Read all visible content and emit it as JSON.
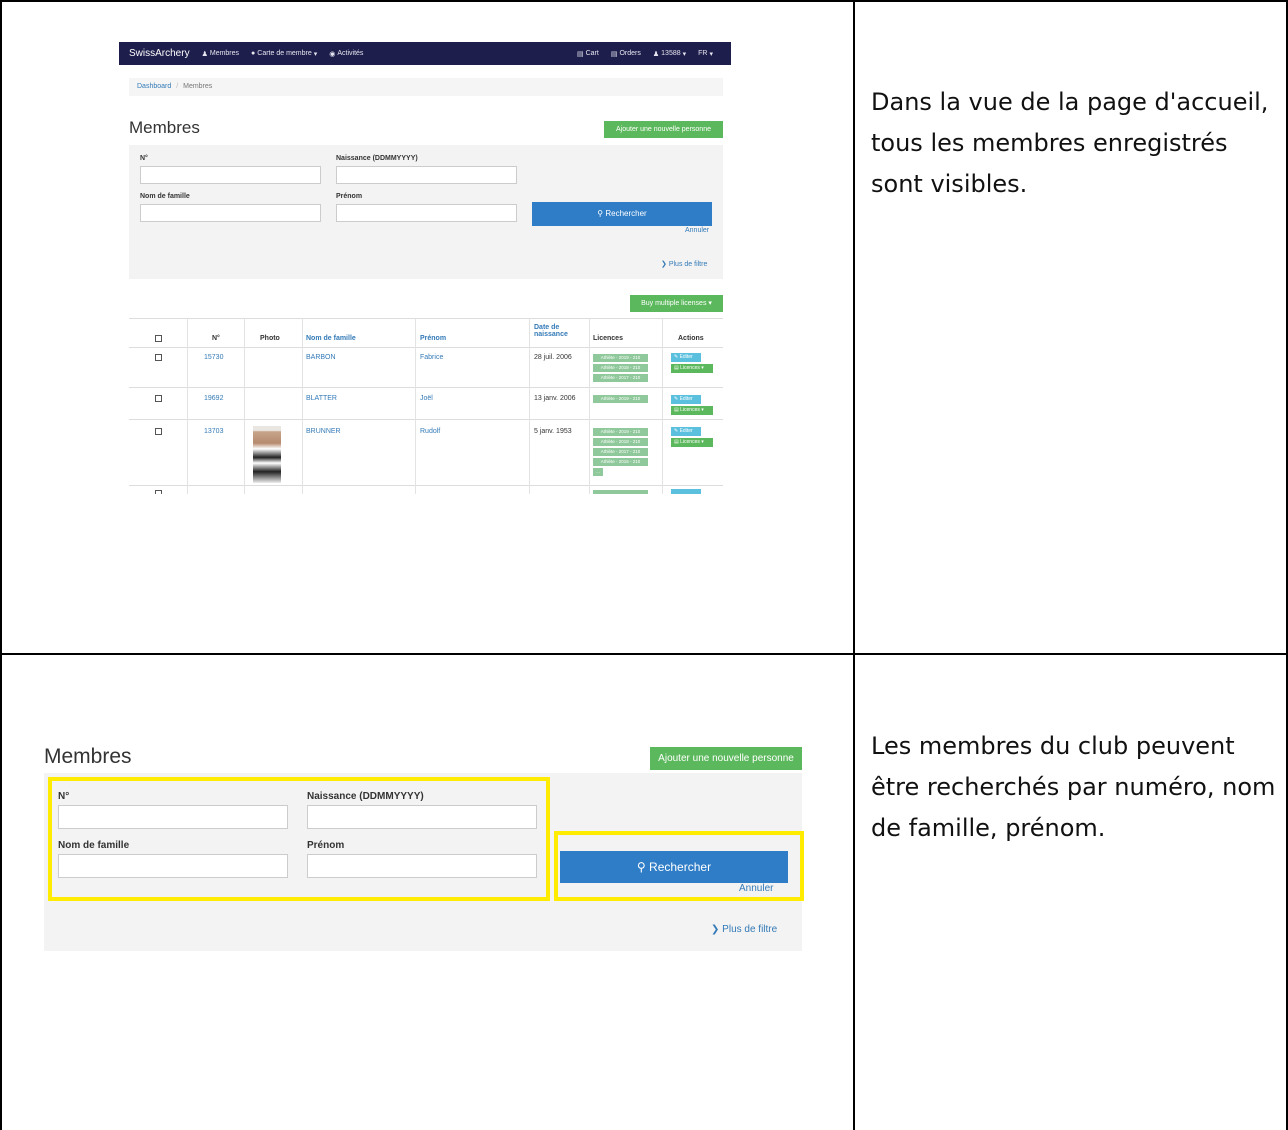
{
  "descriptions": {
    "row1": "Dans la vue de la page d'accueil, tous les membres enregistrés sont visibles.",
    "row2": "Les membres du club peuvent être recherchés par numéro, nom de famille, prénom."
  },
  "navbar": {
    "brand": "SwissArchery",
    "members": "Membres",
    "member_card": "Carte de membre",
    "activities": "Activités",
    "cart": "Cart",
    "orders": "Orders",
    "user": "13588",
    "lang": "FR"
  },
  "breadcrumb": {
    "dashboard": "Dashboard",
    "separator": "/",
    "current": "Membres"
  },
  "page_title": "Membres",
  "add_person_label": "Ajouter une nouvelle personne",
  "search": {
    "number_label": "N°",
    "birth_label": "Naissance (DDMMYYYY)",
    "lastname_label": "Nom de famille",
    "firstname_label": "Prénom",
    "search_button": "Rechercher",
    "cancel": "Annuler",
    "more_filter": "Plus de filtre"
  },
  "buy_multiple_label": "Buy multiple licenses",
  "table": {
    "headers": {
      "number": "N°",
      "photo": "Photo",
      "lastname": "Nom de famille",
      "firstname": "Prénom",
      "birth_line1": "Date de",
      "birth_line2": "naissance",
      "licences": "Licences",
      "actions": "Actions"
    },
    "rows": [
      {
        "number": "15730",
        "lastname": "BARBON",
        "firstname": "Fabrice",
        "birth": "28 juil. 2006",
        "licences": [
          "Athlète - 2019 - 210",
          "Athlète - 2018 - 210",
          "Athlète - 2017 - 210"
        ]
      },
      {
        "number": "19692",
        "lastname": "BLATTER",
        "firstname": "Joël",
        "birth": "13 janv. 2006",
        "licences": [
          "Athlète - 2019 - 210"
        ]
      },
      {
        "number": "13703",
        "lastname": "BRUNNER",
        "firstname": "Rudolf",
        "birth": "5 janv. 1953",
        "licences": [
          "Athlète - 2019 - 210",
          "Athlète - 2018 - 210",
          "Athlète - 2017 - 210",
          "Athlète - 2016 - 210",
          "..."
        ]
      }
    ],
    "edit_label": "Editer",
    "licences_action": "Licences"
  },
  "colors": {
    "navbar": "#1e1e4d",
    "primary": "#2f7dc7",
    "success": "#5cb85c",
    "info": "#5bc0de",
    "highlight": "#ffec00"
  }
}
